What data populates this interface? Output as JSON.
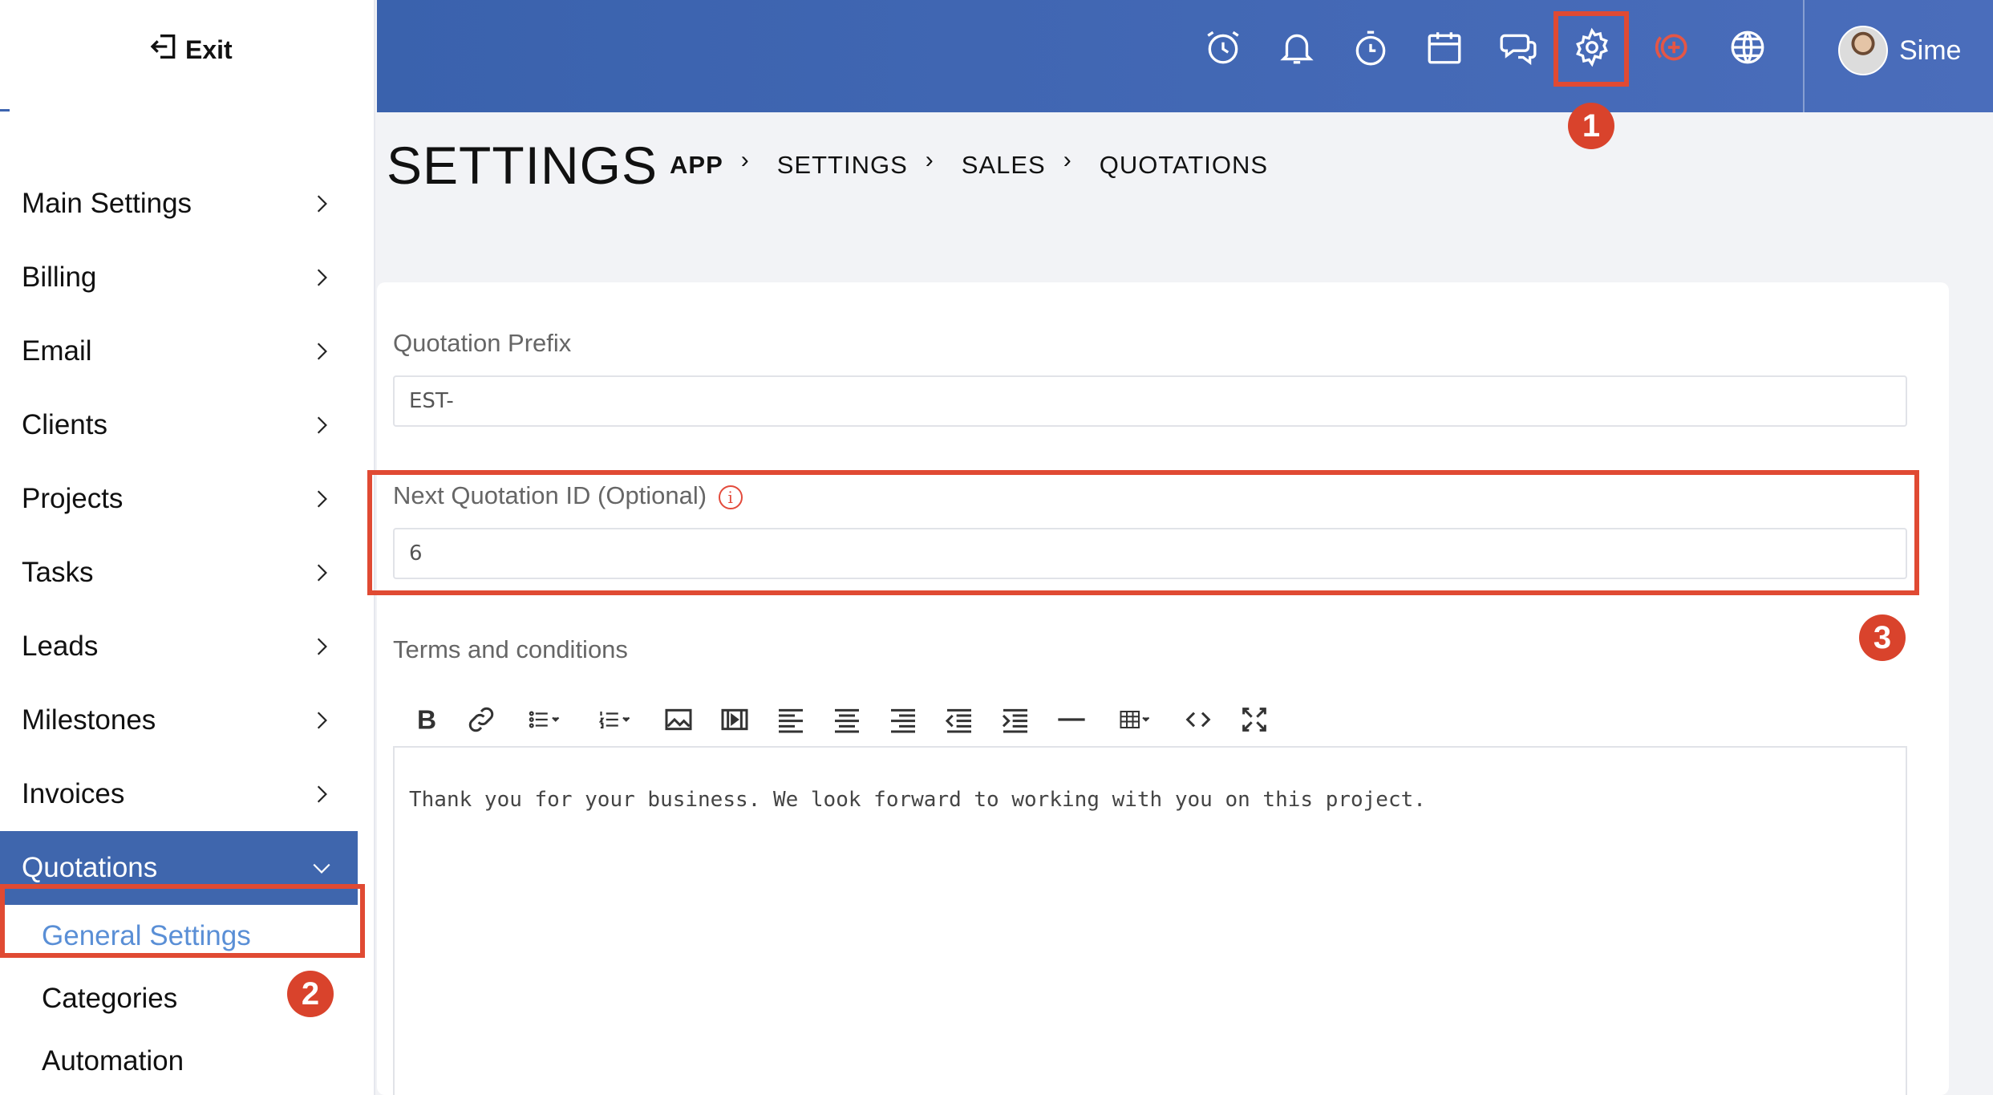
{
  "sidebar": {
    "exit_label": "Exit",
    "items": [
      {
        "label": "Main Settings"
      },
      {
        "label": "Billing"
      },
      {
        "label": "Email"
      },
      {
        "label": "Clients"
      },
      {
        "label": "Projects"
      },
      {
        "label": "Tasks"
      },
      {
        "label": "Leads"
      },
      {
        "label": "Milestones"
      },
      {
        "label": "Invoices"
      }
    ],
    "active_item": {
      "label": "Quotations",
      "expanded": true
    },
    "submenu": [
      {
        "label": "General Settings",
        "current": true
      },
      {
        "label": "Categories"
      },
      {
        "label": "Automation"
      }
    ]
  },
  "header": {
    "icons": [
      "alarm-clock-icon",
      "bell-icon",
      "stopwatch-icon",
      "calendar-icon",
      "chat-icon",
      "gear-icon",
      "add-circle-icon",
      "globe-icon"
    ],
    "user_name": "Sime"
  },
  "page": {
    "title": "SETTINGS",
    "breadcrumb": [
      "APP",
      "SETTINGS",
      "SALES",
      "QUOTATIONS"
    ]
  },
  "form": {
    "prefix_label": "Quotation Prefix",
    "prefix_value": "EST-",
    "next_id_label": "Next Quotation ID (Optional)",
    "next_id_value": "6",
    "terms_label": "Terms and conditions",
    "terms_text": "Thank you for your business. We look forward to working with you on this project.",
    "toolbar_tools": [
      "bold",
      "link",
      "bullet-list",
      "numbered-list",
      "image",
      "video",
      "align-left",
      "align-center",
      "align-right",
      "outdent",
      "indent",
      "horizontal-rule",
      "table",
      "code-view",
      "fullscreen"
    ]
  },
  "annotations": {
    "badges": [
      "1",
      "2",
      "3"
    ],
    "color": "#e04a33"
  },
  "colors": {
    "header": "#3f66ad",
    "active_menu": "#3f66ad",
    "current_submenu": "#5a8fd6"
  }
}
